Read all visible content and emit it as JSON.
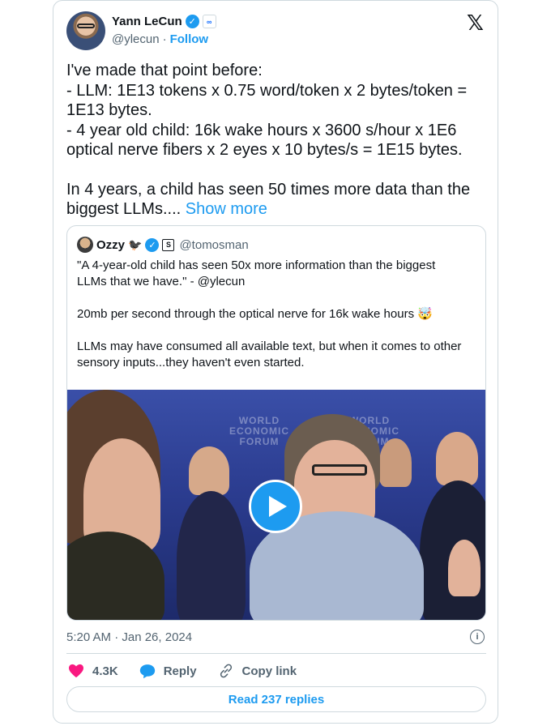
{
  "author": {
    "name": "Yann LeCun",
    "handle": "@ylecun",
    "separator": "·",
    "follow_label": "Follow",
    "affiliation_badge": "∞"
  },
  "platform_icon": "x-logo-icon",
  "tweet": {
    "lines": [
      "I've made that point before:",
      "- LLM: 1E13 tokens x 0.75 word/token x 2 bytes/token =",
      "1E13 bytes.",
      "- 4 year old child: 16k wake hours x 3600 s/hour x 1E6",
      "optical nerve fibers x 2 eyes x 10 bytes/s = 1E15 bytes."
    ],
    "para2_line1": "In 4 years, a child has seen 50 times more data than the",
    "para2_line2": "biggest LLMs....",
    "show_more": "Show more"
  },
  "quote": {
    "name": "Ozzy",
    "bird": "🐦‍⬛",
    "badge": "S",
    "handle": "@tomosman",
    "line1": "\"A 4-year-old child has seen 50x more information than the biggest",
    "line2": "LLMs that we have.\" - @ylecun",
    "line3": "20mb per second through the optical nerve for 16k wake hours 🤯",
    "line4": "LLMs may have consumed all available text, but when it comes to other",
    "line5": "sensory inputs...they haven't even started.",
    "video_backdrop_text": [
      "WORLD",
      "ECONOMIC",
      "FORUM"
    ]
  },
  "meta": {
    "timestamp": "5:20 AM · Jan 26, 2024",
    "info_icon": "i"
  },
  "actions": {
    "likes": "4.3K",
    "reply_label": "Reply",
    "copy_link_label": "Copy link"
  },
  "replies_button": "Read 237 replies",
  "colors": {
    "accent": "#1d9bf0",
    "like": "#f91880",
    "text": "#0f1419",
    "muted": "#536471",
    "border": "#cfd9de"
  }
}
